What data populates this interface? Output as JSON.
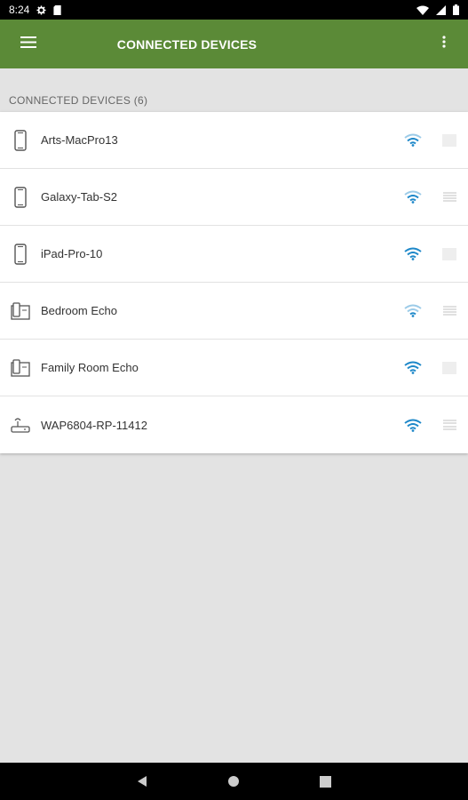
{
  "status_bar": {
    "time": "8:24",
    "icons": [
      "gear-icon",
      "sd-card-icon",
      "wifi-icon",
      "cell-signal-icon",
      "battery-icon"
    ]
  },
  "app_bar": {
    "title": "CONNECTED DEVICES",
    "menu_icon": "hamburger-menu-icon",
    "overflow_icon": "more-vert-icon",
    "color": "#5b8a37"
  },
  "section": {
    "header": "CONNECTED DEVICES (6)"
  },
  "devices": [
    {
      "name": "Arts-MacPro13",
      "icon": "phone-icon",
      "signal": "wifi-signal-icon"
    },
    {
      "name": "Galaxy-Tab-S2",
      "icon": "phone-icon",
      "signal": "wifi-signal-icon"
    },
    {
      "name": "iPad-Pro-10",
      "icon": "phone-icon",
      "signal": "wifi-signal-icon"
    },
    {
      "name": "Bedroom Echo",
      "icon": "smart-speaker-icon",
      "signal": "wifi-signal-icon"
    },
    {
      "name": "Family Room Echo",
      "icon": "smart-speaker-icon",
      "signal": "wifi-signal-icon"
    },
    {
      "name": "WAP6804-RP-11412",
      "icon": "router-icon",
      "signal": "wifi-signal-icon"
    }
  ],
  "colors": {
    "accent_wifi": "#1e88c9",
    "background": "#e3e3e3"
  },
  "nav_bar": {
    "icons": [
      "back-icon",
      "home-icon",
      "recents-icon"
    ]
  }
}
